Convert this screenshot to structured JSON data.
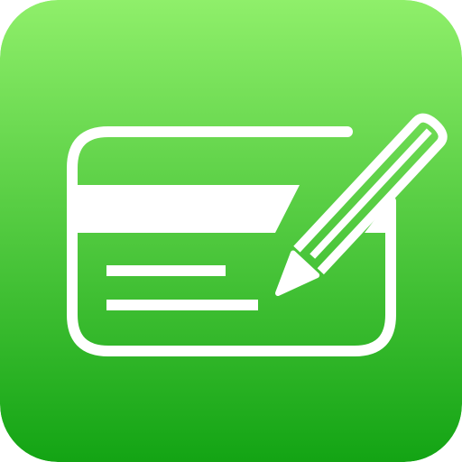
{
  "icon": {
    "name": "credit-card-with-pencil",
    "colors": {
      "gradient_top": "#8FEF6A",
      "gradient_bottom": "#13A414",
      "foreground": "#FFFFFF"
    }
  }
}
